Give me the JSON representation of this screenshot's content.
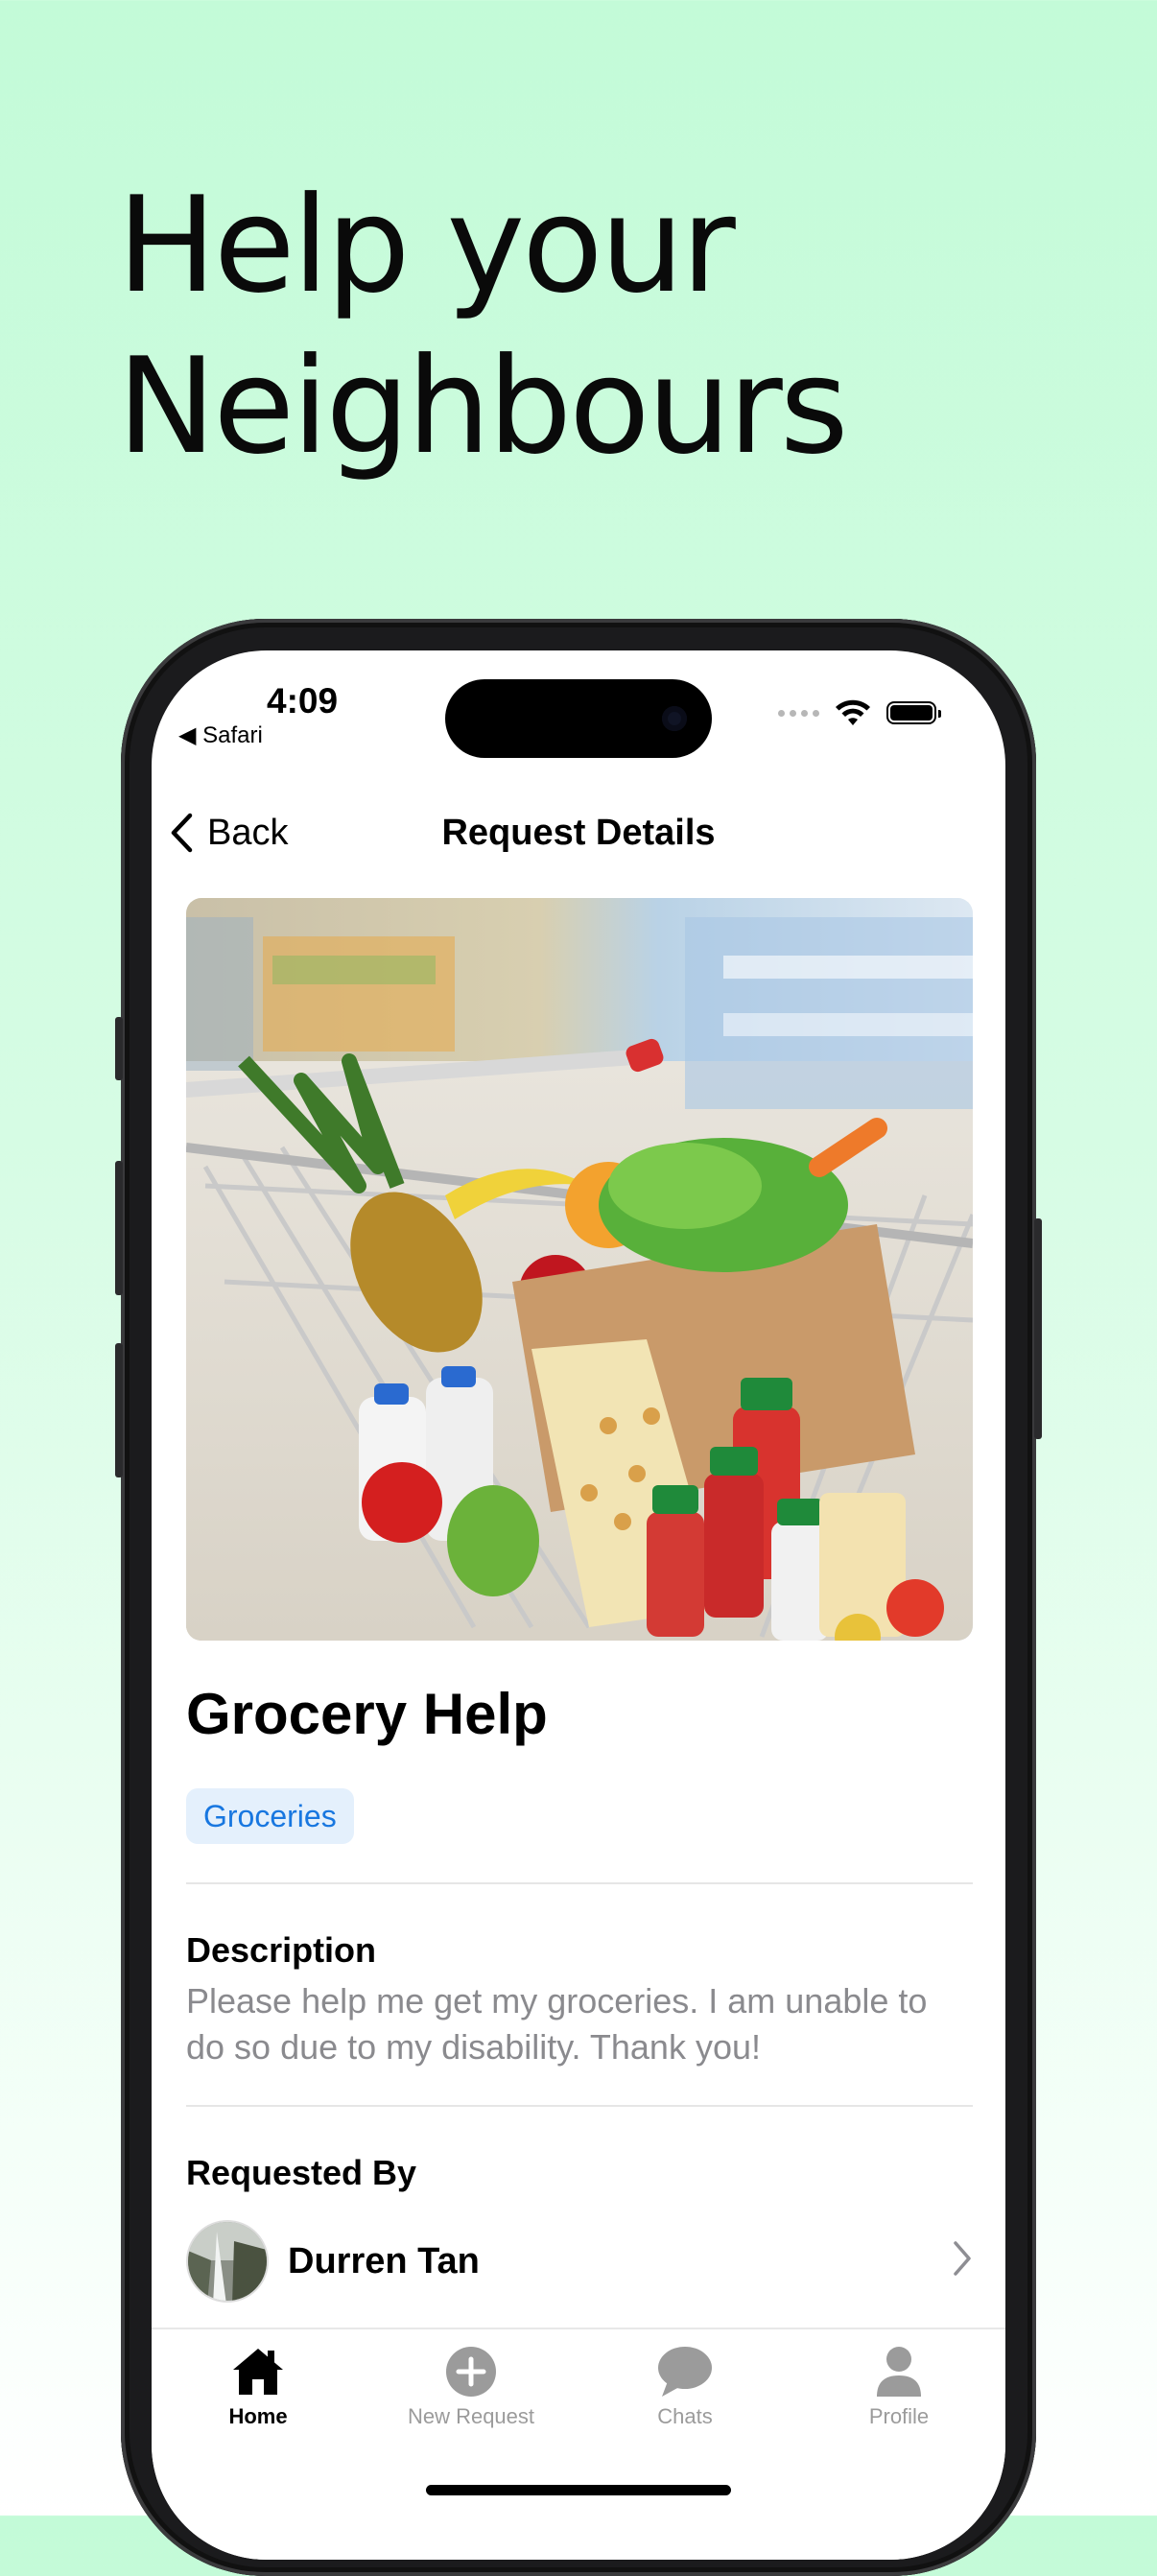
{
  "headline": {
    "line1": "Help your",
    "line2": "Neighbours"
  },
  "status_bar": {
    "time": "4:09",
    "back_app": "◀ Safari"
  },
  "nav": {
    "back_label": "Back",
    "title": "Request Details"
  },
  "request": {
    "title": "Grocery Help",
    "category": "Groceries",
    "description_label": "Description",
    "description": "Please help me get my groceries. I am unable to do so due to my disability. Thank you!",
    "requested_by_label": "Requested By",
    "requester_name": "Durren Tan"
  },
  "tabs": [
    {
      "label": "Home",
      "icon": "house-icon",
      "active": true
    },
    {
      "label": "New Request",
      "icon": "plus-circle-icon",
      "active": false
    },
    {
      "label": "Chats",
      "icon": "chat-bubble-icon",
      "active": false
    },
    {
      "label": "Profile",
      "icon": "person-icon",
      "active": false
    }
  ],
  "colors": {
    "background_top": "#c3fbd8",
    "accent_blue": "#1877e0",
    "tag_background": "#e4f0fc",
    "muted_text": "#8a8a8e",
    "inactive_tab": "#9b9b9b"
  }
}
